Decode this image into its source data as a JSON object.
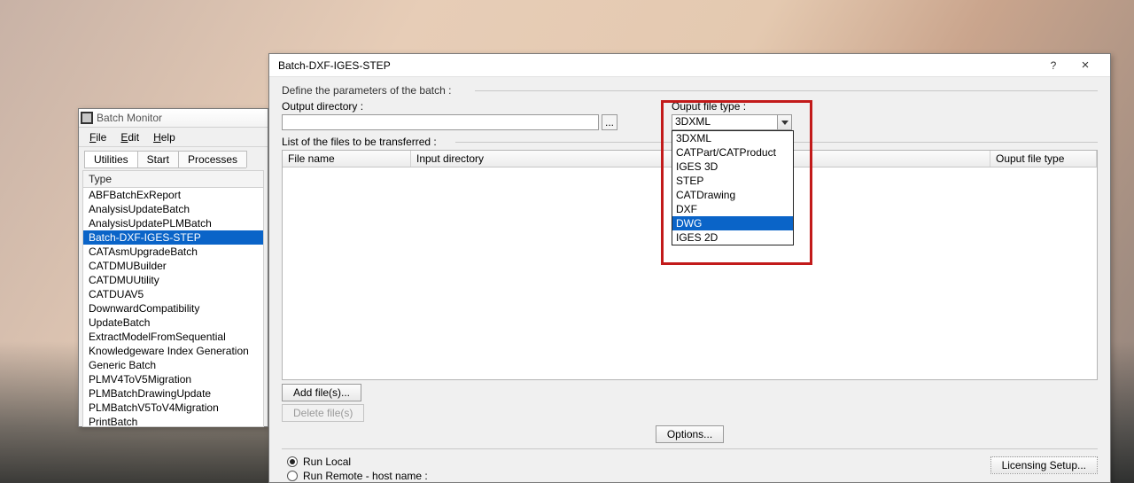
{
  "batch_monitor": {
    "title": "Batch Monitor",
    "menu": {
      "file": "File",
      "edit": "Edit",
      "help": "Help"
    },
    "tabs": {
      "utilities": "Utilities",
      "start": "Start",
      "processes": "Processes"
    },
    "list_header": "Type",
    "items": [
      "ABFBatchExReport",
      "AnalysisUpdateBatch",
      "AnalysisUpdatePLMBatch",
      "Batch-DXF-IGES-STEP",
      "CATAsmUpgradeBatch",
      "CATDMUBuilder",
      "CATDMUUtility",
      "CATDUAV5",
      "DownwardCompatibility",
      "UpdateBatch",
      "ExtractModelFromSequential",
      "Knowledgeware Index Generation",
      "Generic Batch",
      "PLMV4ToV5Migration",
      "PLMBatchDrawingUpdate",
      "PLMBatchV5ToV4Migration",
      "PrintBatch"
    ],
    "selected_index": 3
  },
  "dialog": {
    "title": "Batch-DXF-IGES-STEP",
    "help_text": "?",
    "close_text": "×",
    "group_label": "Define the parameters of the batch :",
    "output_dir_label": "Output directory :",
    "output_dir_value": "",
    "browse_label": "...",
    "output_type_label": "Ouput file type :",
    "output_type_value": "3DXML",
    "output_type_options": [
      "3DXML",
      "CATPart/CATProduct",
      "IGES 3D",
      "STEP",
      "CATDrawing",
      "DXF",
      "DWG",
      "IGES 2D"
    ],
    "output_type_highlight_index": 6,
    "list_files_label": "List of the files to be transferred :",
    "table_headers": {
      "filename": "File name",
      "inputdir": "Input directory",
      "outtype": "Ouput file type"
    },
    "buttons": {
      "add": "Add file(s)...",
      "delete": "Delete file(s)",
      "options": "Options...",
      "licensing": "Licensing Setup..."
    },
    "run": {
      "local": "Run Local",
      "remote": "Run Remote - host name :"
    }
  }
}
